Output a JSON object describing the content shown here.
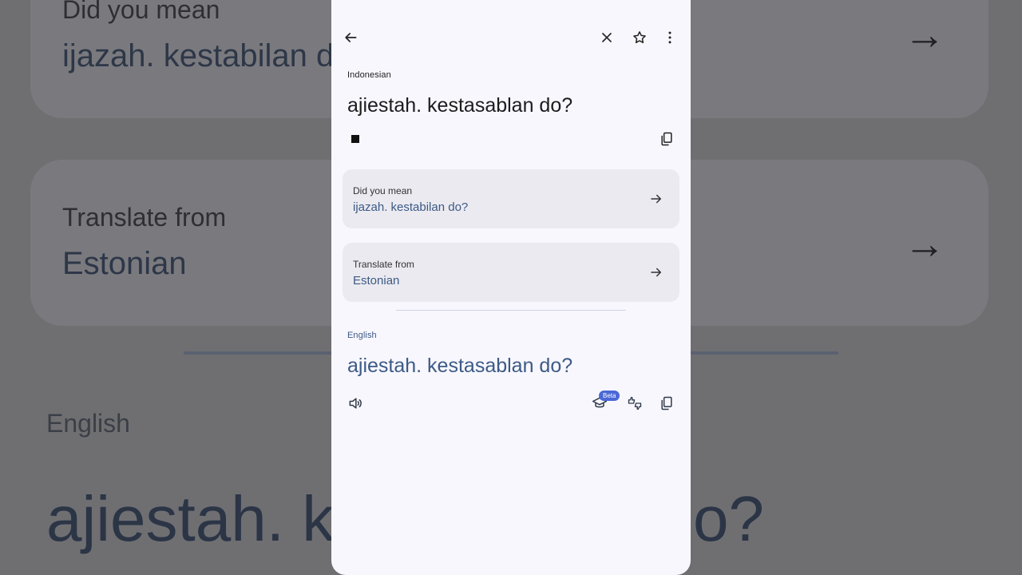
{
  "background": {
    "did_you_mean_caption": "Did you mean",
    "did_you_mean_value": "ijazah. kestabilan d",
    "translate_from_caption": "Translate from",
    "translate_from_value": "Estonian",
    "target_lang": "English",
    "target_text_left": "ajiestah. ke",
    "target_text_right": "o?"
  },
  "toolbar": {
    "back_icon": "arrow-left-icon",
    "close_icon": "close-icon",
    "star_icon": "star-icon",
    "more_icon": "more-vert-icon"
  },
  "source": {
    "language": "Indonesian",
    "text": "ajiestah. kestasablan do?"
  },
  "suggestion": {
    "caption": "Did you mean",
    "value": "ijazah. kestabilan do?"
  },
  "detected": {
    "caption": "Translate from",
    "value": "Estonian"
  },
  "target": {
    "language": "English",
    "text": "ajiestah. kestasablan do?",
    "beta_label": "Beta"
  },
  "colors": {
    "accent_text": "#3c5a86",
    "beta_badge": "#4b68d6",
    "panel_bg": "#f8f7fd",
    "card_bg": "#ebeaf0"
  }
}
